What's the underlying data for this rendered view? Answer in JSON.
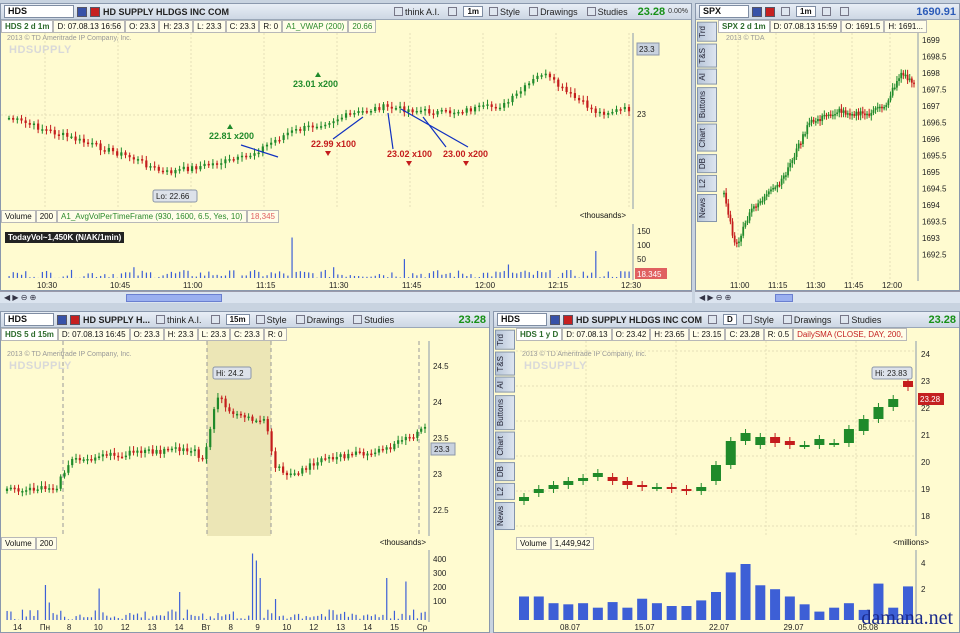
{
  "top_left": {
    "symbol": "HDS",
    "company": "HD SUPPLY HLDGS INC COM",
    "think_ai": "think A.I.",
    "period": "1m",
    "style": "Style",
    "drawings": "Drawings",
    "studies": "Studies",
    "last": "23.28",
    "pct": "0.00%",
    "info": {
      "sym": "HDS 2 d 1m",
      "d": "D: 07.08.13 16:56",
      "o": "O: 23.3",
      "h": "H: 23.3",
      "l": "L: 23.3",
      "c": "C: 23.3",
      "r": "R: 0",
      "study": "A1_VWAP (200)",
      "study_val": "20.66"
    },
    "copyright": "2013 © TD Ameritrade IP Company, Inc.",
    "logo": "HDSUPPLY",
    "annotations": [
      "22.81 x200",
      "23.01 x200",
      "22.99 x100",
      "23.02 x100",
      "23.00 x200"
    ],
    "lo_label": "Lo: 22.66",
    "price_axis": [
      "23.3",
      "23"
    ],
    "volume": {
      "label": "Volume",
      "n": "200",
      "study": "A1_AvgVolPerTimeFrame (930, 1600, 6.5, Yes, 10)",
      "study_val": "18,345",
      "units": "<thousands>",
      "today": "TodayVol~1,450K (N/AK/1min)",
      "axis": [
        "150",
        "100",
        "50"
      ],
      "tag": "18.345"
    },
    "time_axis": [
      "10:30",
      "10:45",
      "11:00",
      "11:15",
      "11:30",
      "11:45",
      "12:00",
      "12:15",
      "12:30"
    ]
  },
  "top_right": {
    "symbol": "SPX",
    "period": "1m",
    "last": "1690.91",
    "info": {
      "sym": "SPX 2 d 1m",
      "d": "D: 07.08.13 15:59",
      "o": "O: 1691.5",
      "h": "H: 1691..."
    },
    "copyright": "2013 © TDA",
    "price_axis": [
      "1699",
      "1698.5",
      "1698",
      "1697.5",
      "1697",
      "1696.5",
      "1696",
      "1695.5",
      "1695",
      "1694.5",
      "1694",
      "1693.5",
      "1693",
      "1692.5"
    ],
    "time_axis": [
      "11:00",
      "11:15",
      "11:30",
      "11:45",
      "12:00"
    ],
    "sidetabs": [
      "Trd",
      "T&S",
      "AI",
      "Buttons",
      "Chart",
      "DB",
      "L2",
      "News"
    ]
  },
  "bottom_left": {
    "symbol": "HDS",
    "company": "HD SUPPLY H...",
    "think_ai": "think A.I.",
    "period": "15m",
    "style": "Style",
    "drawings": "Drawings",
    "studies": "Studies",
    "last": "23.28",
    "info": {
      "sym": "HDS 5 d 15m",
      "d": "D: 07.08.13 16:45",
      "o": "O: 23.3",
      "h": "H: 23.3",
      "l": "L: 23.3",
      "c": "C: 23.3",
      "r": "R: 0"
    },
    "copyright": "2013 © TD Ameritrade IP Company, Inc.",
    "logo": "HDSUPPLY",
    "hi_label": "Hi: 24.2",
    "price_axis": [
      "24.5",
      "24",
      "23.5",
      "23",
      "22.5"
    ],
    "tag": "23.3",
    "volume": {
      "label": "Volume",
      "n": "200",
      "units": "<thousands>",
      "axis": [
        "400",
        "300",
        "200",
        "100"
      ]
    },
    "time_axis": [
      "14",
      "Пн",
      "8",
      "10",
      "12",
      "13",
      "14",
      "Вт",
      "8",
      "9",
      "10",
      "12",
      "13",
      "14",
      "15",
      "Ср"
    ]
  },
  "bottom_right": {
    "symbol": "HDS",
    "company": "HD SUPPLY HLDGS INC COM",
    "period": "D",
    "style": "Style",
    "drawings": "Drawings",
    "studies": "Studies",
    "last": "23.28",
    "info": {
      "sym": "HDS 1 y D",
      "d": "D: 07.08.13",
      "o": "O: 23.42",
      "h": "H: 23.65",
      "l": "L: 23.15",
      "c": "C: 23.28",
      "r": "R: 0.5",
      "study": "DailySMA (CLOSE, DAY, 200,"
    },
    "copyright": "2013 © TD Ameritrade IP Company, Inc.",
    "logo": "HDSUPPLY",
    "hi_label": "Hi: 23.83",
    "price_axis": [
      "24",
      "23",
      "22",
      "21",
      "20",
      "19",
      "18"
    ],
    "tag": "23.28",
    "volume": {
      "label": "Volume",
      "value": "1,449,942",
      "units": "<millions>",
      "axis": [
        "4",
        "2"
      ]
    },
    "time_axis": [
      "08.07",
      "15.07",
      "22.07",
      "29.07",
      "05.08"
    ],
    "sidetabs": [
      "Trd",
      "T&S",
      "AI",
      "Buttons",
      "Chart",
      "DB",
      "L2",
      "News"
    ]
  },
  "watermark": "damana.net",
  "colors": {
    "up": "#1f8a2a",
    "down": "#c41c1c",
    "panel": "#fffbd0",
    "volume": "#3d5fd6"
  }
}
